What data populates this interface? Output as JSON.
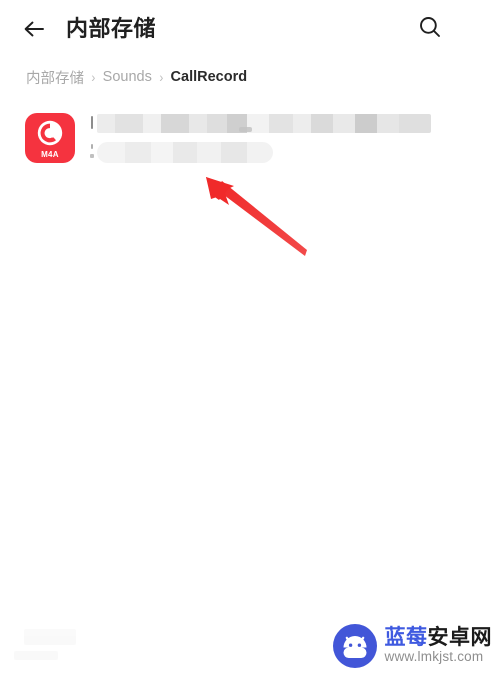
{
  "appbar": {
    "back_icon": "back-arrow-icon",
    "title": "内部存储",
    "search_icon": "search-icon",
    "more_icon": "more-vertical-icon"
  },
  "breadcrumb": {
    "separator": "›",
    "items": [
      {
        "label": "内部存储",
        "active": false
      },
      {
        "label": "Sounds",
        "active": false
      },
      {
        "label": "CallRecord",
        "active": true
      }
    ]
  },
  "file_list": {
    "items": [
      {
        "icon_name": "m4a-audio-file-icon",
        "extension": "M4A",
        "name_redacted": true,
        "name": "",
        "meta_redacted": true,
        "meta": ""
      }
    ]
  },
  "annotation": {
    "arrow_name": "red-pointer-arrow",
    "color": "#f03030",
    "points_to": "file-list-item-name"
  },
  "watermark": {
    "logo_name": "android-robot-logo-icon",
    "title_primary": "蓝莓",
    "title_secondary": "安卓网",
    "url": "www.lmkjst.com"
  },
  "colors": {
    "accent_red": "#f5333f",
    "arrow_red": "#f03030",
    "watermark_blue": "#3f5ae0",
    "title_dark": "#202020",
    "crumb_inactive": "#a8a8a8",
    "crumb_active": "#2b2b2b",
    "background": "#ffffff"
  }
}
